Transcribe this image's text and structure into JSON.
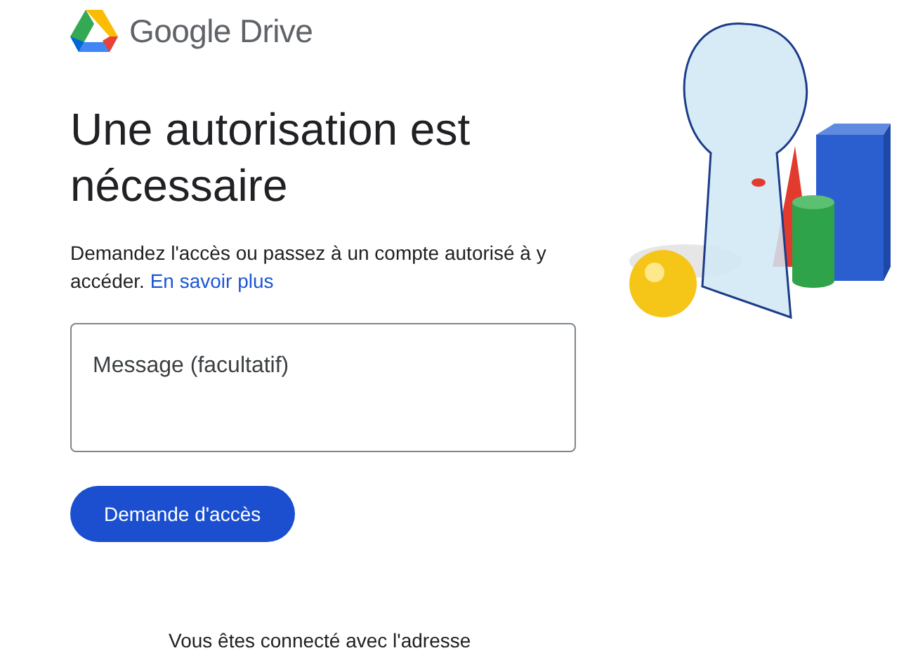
{
  "header": {
    "logo_text": "Google Drive"
  },
  "title": "Une autorisation est nécessaire",
  "description": {
    "text": "Demandez l'accès ou passez à un compte autorisé à y accéder.",
    "link": "En savoir plus"
  },
  "message_field": {
    "placeholder": "Message (facultatif)"
  },
  "request_button": "Demande d'accès",
  "signed_in_text": "Vous êtes connecté avec l'adresse"
}
